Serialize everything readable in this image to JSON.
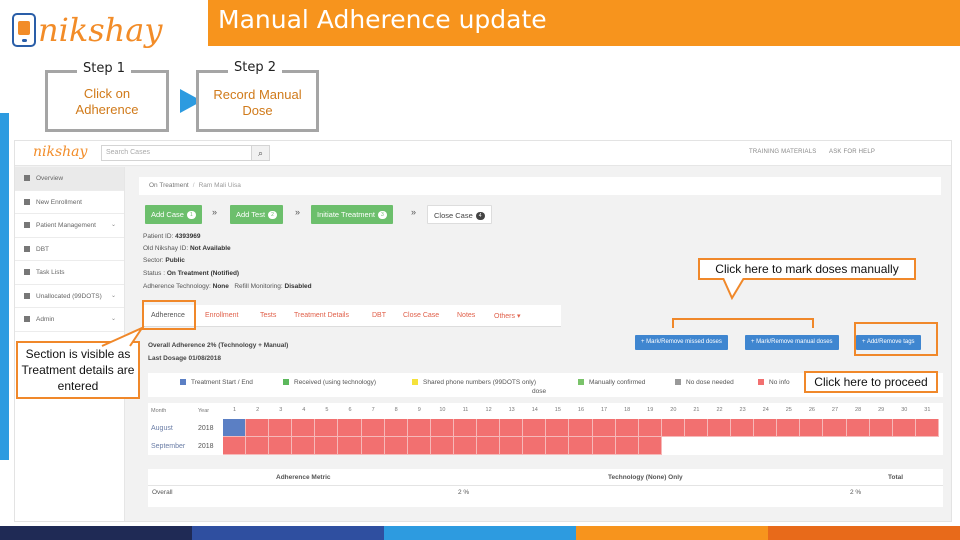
{
  "slide": {
    "title": "Manual Adherence update",
    "logo_text": "nikshay",
    "step1": {
      "label": "Step 1",
      "text": "Click on Adherence"
    },
    "step2": {
      "label": "Step 2",
      "text": "Record Manual Dose"
    },
    "annotations": {
      "mark_doses": "Click here to mark doses manually",
      "section_visible": "Section is visible as Treatment details are entered",
      "proceed": "Click here to proceed"
    },
    "colors": {
      "accent": "#f7941d",
      "arrow": "#2d9be0",
      "annotation_border": "#f0882a"
    }
  },
  "app": {
    "logo": "nikshay",
    "search_placeholder": "Search Cases",
    "search_icon": "search-icon",
    "top_links": [
      "TRAINING MATERIALS",
      "ASK FOR HELP"
    ],
    "sidebar": [
      {
        "label": "Overview",
        "icon": "home-icon",
        "active": true
      },
      {
        "label": "New Enrollment",
        "icon": "plus-icon"
      },
      {
        "label": "Patient Management",
        "icon": "user-icon",
        "expand": true
      },
      {
        "label": "DBT",
        "icon": "money-icon"
      },
      {
        "label": "Task Lists",
        "icon": "list-icon"
      },
      {
        "label": "Unallocated (99DOTS)",
        "icon": "alert-icon",
        "expand": true
      },
      {
        "label": "Admin",
        "icon": "admin-icon",
        "expand": true
      }
    ],
    "breadcrumb": {
      "root": "On Treatment",
      "separator": "/",
      "current": "Ram Mali Uisa"
    },
    "workflow": [
      {
        "label": "Add Case",
        "count": "1"
      },
      {
        "label": "Add Test",
        "count": "2"
      },
      {
        "label": "Initiate Treatment",
        "count": "3"
      },
      {
        "label": "Close Case",
        "count": "4"
      }
    ],
    "patient": {
      "id_label": "Patient ID:",
      "id": "4393969",
      "old_id_label": "Old Nikshay ID:",
      "old_id": "Not Available",
      "sector_label": "Sector:",
      "sector": "Public",
      "status_label": "Status :",
      "status": "On Treatment (Notified)",
      "tech_label": "Adherence Technology:",
      "tech": "None",
      "refill_label": "Refill Monitoring:",
      "refill": "Disabled"
    },
    "tabs": [
      "Adherence",
      "Enrollment",
      "Tests",
      "Treatment Details",
      "DBT",
      "Close Case",
      "Notes",
      "Others ▾"
    ],
    "actions": [
      "Mark/Remove missed doses",
      "Mark/Remove manual doses",
      "Add/Remove tags"
    ],
    "adherence": {
      "overall": "Overall Adherence 2% (Technology + Manual)",
      "last_dosage": "Last Dosage 01/08/2018"
    },
    "legend": [
      {
        "label": "Treatment Start / End",
        "color": "#5b7fc4"
      },
      {
        "label": "Received (using technology)",
        "color": "#5cb85c"
      },
      {
        "label": "Shared phone numbers (99DOTS only)",
        "color": "#f5e23b"
      },
      {
        "label": "dose",
        "color": ""
      },
      {
        "label": "Manually confirmed",
        "color": "#7ac36a"
      },
      {
        "label": "No dose needed",
        "color": "#999999"
      },
      {
        "label": "No info",
        "color": "#f27070"
      }
    ],
    "calendar": {
      "month_header": "Month",
      "year_header": "Year",
      "days": [
        "1",
        "2",
        "3",
        "4",
        "5",
        "6",
        "7",
        "8",
        "9",
        "10",
        "11",
        "12",
        "13",
        "14",
        "15",
        "16",
        "17",
        "18",
        "19",
        "20",
        "21",
        "22",
        "23",
        "24",
        "25",
        "26",
        "27",
        "28",
        "29",
        "30",
        "31"
      ],
      "rows": [
        {
          "month": "August",
          "year": "2018",
          "start_day": 1,
          "filled_days": 31
        },
        {
          "month": "September",
          "year": "2018",
          "start_day": 0,
          "filled_days": 19
        }
      ],
      "colors": {
        "start": "#5b7fc4",
        "no_info": "#f27070"
      }
    },
    "metric": {
      "headers": [
        "Adherence Metric",
        "Technology (None) Only",
        "Total"
      ],
      "row": [
        "Overall",
        "2 %",
        "2 %"
      ]
    }
  }
}
